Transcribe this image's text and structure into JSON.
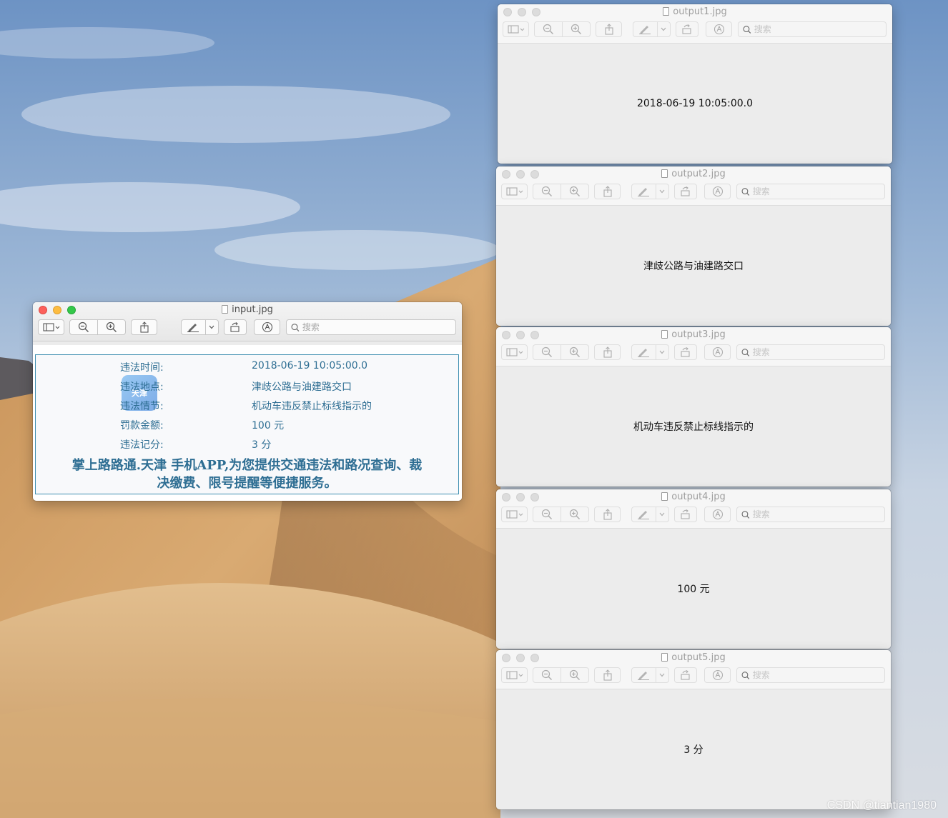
{
  "desktop": {
    "watermark_text": "CSDN @tiantian1980"
  },
  "toolbar": {
    "search_placeholder": "搜索"
  },
  "input_window": {
    "title": "input.jpg",
    "ticket": {
      "rows": [
        {
          "label": "违法时间:",
          "value": "2018-06-19 10:05:00.0"
        },
        {
          "label": "违法地点:",
          "value": "津歧公路与油建路交口"
        },
        {
          "label": "违法情节:",
          "value": "机动车违反禁止标线指示的"
        },
        {
          "label": "罚款金额:",
          "value": "100 元"
        },
        {
          "label": "违法记分:",
          "value": "3 分"
        }
      ],
      "slogan_line1": "掌上路路通.天津 手机APP,为您提供交通违法和路况查询、裁",
      "slogan_line2": "决缴费、限号提醒等便捷服务。",
      "logo_text": "天津"
    }
  },
  "output_windows": [
    {
      "title": "output1.jpg",
      "text": "2018-06-19 10:05:00.0"
    },
    {
      "title": "output2.jpg",
      "text": "津歧公路与油建路交口"
    },
    {
      "title": "output3.jpg",
      "text": "机动车违反禁止标线指示的"
    },
    {
      "title": "output4.jpg",
      "text": "100 元"
    },
    {
      "title": "output5.jpg",
      "text": "3 分"
    }
  ],
  "colors": {
    "ticket_text": "#2e6e93",
    "ticket_border": "#3f8fb0",
    "close": "#fc605b",
    "minimize": "#fdbc40",
    "zoom": "#34c84a"
  }
}
